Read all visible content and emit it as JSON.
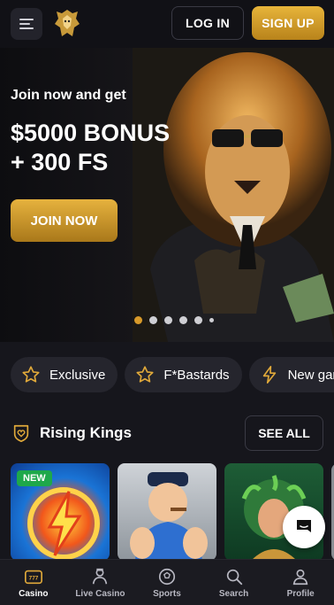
{
  "header": {
    "menu_icon": "hamburger-icon",
    "logo_icon": "lion-logo-icon",
    "login_label": "LOG IN",
    "signup_label": "SIGN UP"
  },
  "hero": {
    "kicker": "Join now and get",
    "headline": "$5000 BONUS + 300 FS",
    "cta_label": "JOIN NOW",
    "carousel": {
      "slide_count": 6,
      "active_index": 0
    }
  },
  "categories": [
    {
      "label": "Exclusive",
      "icon": "star-icon"
    },
    {
      "label": "F*Bastards",
      "icon": "star-icon"
    },
    {
      "label": "New games",
      "icon": "lightning-icon"
    }
  ],
  "section": {
    "icon": "heart-shield-icon",
    "title": "Rising Kings",
    "see_all_label": "SEE ALL"
  },
  "games": [
    {
      "icon": "lightning-game-icon",
      "badge": "NEW"
    },
    {
      "icon": "sailor-game-icon",
      "badge": ""
    },
    {
      "icon": "medusa-game-icon",
      "badge": ""
    },
    {
      "icon": "game-tile",
      "badge": ""
    }
  ],
  "chat": {
    "icon": "chat-icon"
  },
  "bottom_nav": [
    {
      "label": "Casino",
      "icon": "slot-machine-icon",
      "active": true
    },
    {
      "label": "Live Casino",
      "icon": "dealer-icon",
      "active": false
    },
    {
      "label": "Sports",
      "icon": "soccer-ball-icon",
      "active": false
    },
    {
      "label": "Search",
      "icon": "search-icon",
      "active": false
    },
    {
      "label": "Profile",
      "icon": "user-icon",
      "active": false
    }
  ],
  "colors": {
    "accent_gold": "#e0a93a",
    "background": "#16161c",
    "new_badge": "#1ea84a"
  }
}
